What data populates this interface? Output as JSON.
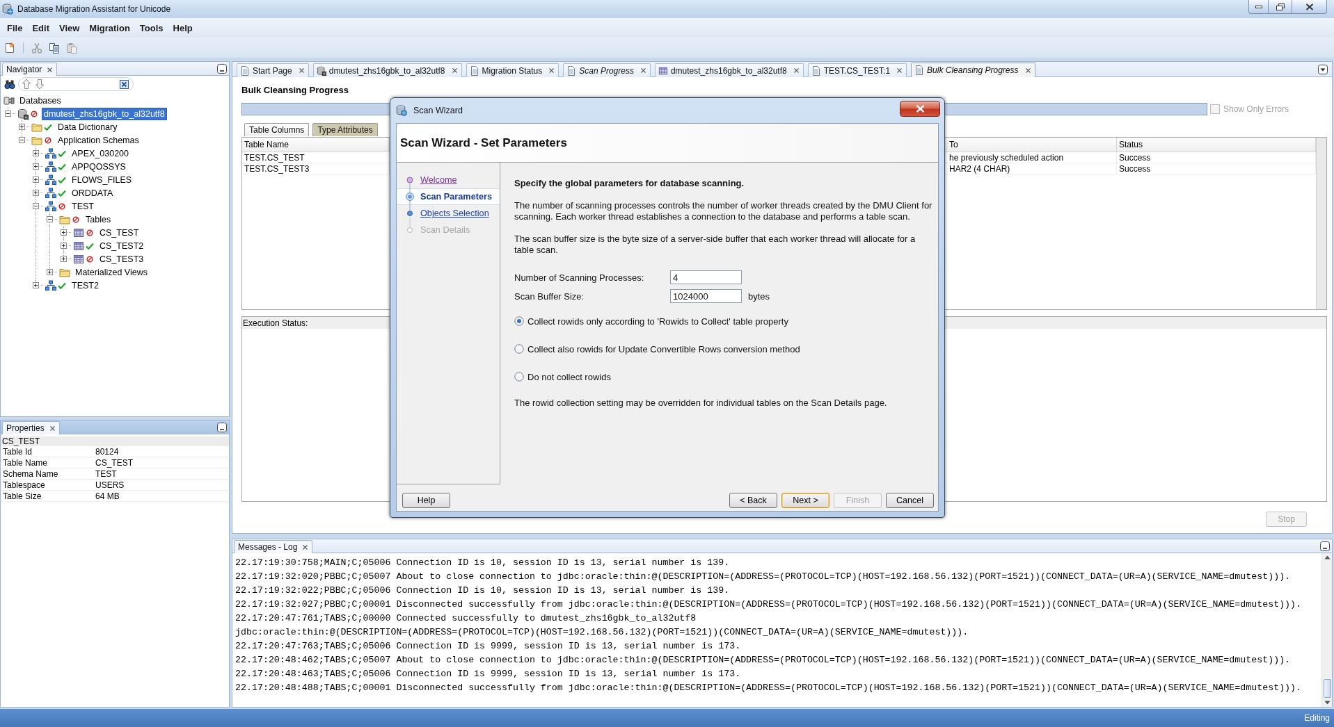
{
  "window": {
    "title": "Database Migration Assistant for Unicode"
  },
  "menu": [
    "File",
    "Edit",
    "View",
    "Migration",
    "Tools",
    "Help"
  ],
  "toolbar": [
    {
      "kind": "new",
      "disabled": false
    },
    {
      "kind": "cut",
      "disabled": true
    },
    {
      "kind": "copy",
      "disabled": false
    },
    {
      "kind": "paste",
      "disabled": true
    }
  ],
  "navigator": {
    "title": "Navigator",
    "tree": [
      {
        "label": "Databases",
        "kind": "connections",
        "selected": false,
        "children": [
          {
            "label": "dmutest_zhs16gbk_to_al32utf8",
            "kind": "database",
            "ok": false,
            "expanded": true,
            "selected": true,
            "children": [
              {
                "label": "Data Dictionary",
                "kind": "folder",
                "ok": true,
                "expanded": false,
                "selected": false
              },
              {
                "label": "Application Schemas",
                "kind": "folder",
                "ok": false,
                "expanded": true,
                "selected": false,
                "children": [
                  {
                    "label": "APEX_030200",
                    "kind": "schema",
                    "ok": true,
                    "expanded": false,
                    "selected": false
                  },
                  {
                    "label": "APPQOSSYS",
                    "kind": "schema",
                    "ok": true,
                    "expanded": false,
                    "selected": false
                  },
                  {
                    "label": "FLOWS_FILES",
                    "kind": "schema",
                    "ok": true,
                    "expanded": false,
                    "selected": false
                  },
                  {
                    "label": "ORDDATA",
                    "kind": "schema",
                    "ok": true,
                    "expanded": false,
                    "selected": false
                  },
                  {
                    "label": "TEST",
                    "kind": "schema",
                    "ok": false,
                    "expanded": true,
                    "selected": false,
                    "children": [
                      {
                        "label": "Tables",
                        "kind": "folder",
                        "ok": false,
                        "expanded": true,
                        "selected": false,
                        "children": [
                          {
                            "label": "CS_TEST",
                            "kind": "table",
                            "ok": false,
                            "expanded": false,
                            "selected": false
                          },
                          {
                            "label": "CS_TEST2",
                            "kind": "table",
                            "ok": true,
                            "expanded": false,
                            "selected": false
                          },
                          {
                            "label": "CS_TEST3",
                            "kind": "table",
                            "ok": false,
                            "expanded": false,
                            "selected": false
                          }
                        ]
                      },
                      {
                        "label": "Materialized Views",
                        "kind": "folder",
                        "expanded": false,
                        "selected": false
                      }
                    ]
                  },
                  {
                    "label": "TEST2",
                    "kind": "schema",
                    "ok": true,
                    "expanded": false,
                    "selected": false
                  }
                ]
              }
            ]
          }
        ]
      }
    ]
  },
  "properties": {
    "title": "Properties",
    "heading": "CS_TEST",
    "rows": [
      {
        "name": "Table Id",
        "value": "80124"
      },
      {
        "name": "Table Name",
        "value": "CS_TEST"
      },
      {
        "name": "Schema Name",
        "value": "TEST"
      },
      {
        "name": "Tablespace",
        "value": "USERS"
      },
      {
        "name": "Table Size",
        "value": "64 MB"
      }
    ]
  },
  "editor": {
    "tabs": [
      {
        "label": "Start Page",
        "kind": "page",
        "preview": false,
        "selected": false
      },
      {
        "label": "dmutest_zhs16gbk_to_al32utf8",
        "kind": "database",
        "preview": false,
        "selected": false
      },
      {
        "label": "Migration Status",
        "kind": "page",
        "preview": false,
        "selected": false
      },
      {
        "label": "Scan Progress",
        "kind": "page",
        "preview": true,
        "selected": false
      },
      {
        "label": "dmutest_zhs16gbk_to_al32utf8",
        "kind": "table",
        "preview": false,
        "selected": false
      },
      {
        "label": "TEST.CS_TEST:1",
        "kind": "page",
        "preview": false,
        "selected": false
      },
      {
        "label": "Bulk Cleansing Progress",
        "kind": "page",
        "preview": true,
        "selected": true
      }
    ],
    "title": "Bulk Cleansing Progress",
    "progress": {
      "level": 1
    },
    "filter": {
      "label": "Show Only Errors",
      "checked": false,
      "disabled": true
    },
    "subtabs": [
      {
        "label": "Table Columns",
        "selected": true
      },
      {
        "label": "Type Attributes",
        "selected": false
      }
    ],
    "table": {
      "columns": [
        "Table Name",
        "To",
        "Status"
      ],
      "rows": [
        [
          "TEST.CS_TEST",
          "he previously scheduled action",
          "Success"
        ],
        [
          "TEST.CS_TEST3",
          "HAR2 (4 CHAR)",
          "Success"
        ]
      ]
    },
    "execution_status": {
      "label": "Execution Status:"
    },
    "stop": {
      "label": "Stop",
      "disabled": true
    }
  },
  "messages": {
    "title": "Messages - Log",
    "lines": [
      "22.17:19:30:758;MAIN;C;05006 Connection ID is 10, session ID is 13, serial number is 139.",
      "22.17:19:32:020;PBBC;C;05007 About to close connection to jdbc:oracle:thin:@(DESCRIPTION=(ADDRESS=(PROTOCOL=TCP)(HOST=192.168.56.132)(PORT=1521))(CONNECT_DATA=(UR=A)(SERVICE_NAME=dmutest))).",
      "22.17:19:32:022;PBBC;C;05006 Connection ID is 10, session ID is 13, serial number is 139.",
      "22.17:19:32:027;PBBC;C;00001 Disconnected successfully from jdbc:oracle:thin:@(DESCRIPTION=(ADDRESS=(PROTOCOL=TCP)(HOST=192.168.56.132)(PORT=1521))(CONNECT_DATA=(UR=A)(SERVICE_NAME=dmutest))).",
      "22.17:20:47:761;TABS;C;00000 Connected successfully to dmutest_zhs16gbk_to_al32utf8",
      "jdbc:oracle:thin:@(DESCRIPTION=(ADDRESS=(PROTOCOL=TCP)(HOST=192.168.56.132)(PORT=1521))(CONNECT_DATA=(UR=A)(SERVICE_NAME=dmutest))).",
      "22.17:20:47:763;TABS;C;05006 Connection ID is 9999, session ID is 13, serial number is 173.",
      "22.17:20:48:462;TABS;C;05007 About to close connection to jdbc:oracle:thin:@(DESCRIPTION=(ADDRESS=(PROTOCOL=TCP)(HOST=192.168.56.132)(PORT=1521))(CONNECT_DATA=(UR=A)(SERVICE_NAME=dmutest))).",
      "22.17:20:48:463;TABS;C;05006 Connection ID is 9999, session ID is 13, serial number is 173.",
      "22.17:20:48:488;TABS;C;00001 Disconnected successfully from jdbc:oracle:thin:@(DESCRIPTION=(ADDRESS=(PROTOCOL=TCP)(HOST=192.168.56.132)(PORT=1521))(CONNECT_DATA=(UR=A)(SERVICE_NAME=dmutest)))."
    ]
  },
  "status_bar": {
    "text": "Editing"
  },
  "dialog": {
    "title": "Scan Wizard",
    "heading": "Scan Wizard - Set Parameters",
    "steps": [
      {
        "label": "Welcome",
        "kind": "visited",
        "selected": false
      },
      {
        "label": "Scan Parameters",
        "kind": "current",
        "selected": true
      },
      {
        "label": "Objects Selection",
        "kind": "available",
        "selected": false
      },
      {
        "label": "Scan Details",
        "kind": "unavailable",
        "selected": false
      }
    ],
    "intro": "Specify the global parameters for database scanning.",
    "paragraphs": [
      "The number of scanning processes controls the number of worker threads created by the DMU Client for scanning. Each worker thread establishes a connection to the database and performs a table scan.",
      "The scan buffer size is the byte size of a server-side buffer that each worker thread will allocate for a table scan."
    ],
    "fields": [
      {
        "label": "Number of Scanning Processes:",
        "value": "4"
      },
      {
        "label": "Scan Buffer Size:",
        "value": "1024000",
        "unit": "bytes"
      }
    ],
    "options": [
      {
        "label": "Collect rowids only according to 'Rowids to Collect' table property",
        "selected": true
      },
      {
        "label": "Collect also rowids for Update Convertible Rows conversion method",
        "selected": false
      },
      {
        "label": "Do not collect rowids",
        "selected": false
      }
    ],
    "note": "The rowid collection setting may be overridden for individual tables on the Scan Details page.",
    "buttons": [
      {
        "label": "Help",
        "kind": "help",
        "disabled": false,
        "default": false
      },
      {
        "label": "< Back",
        "kind": "navigation",
        "disabled": false,
        "default": false
      },
      {
        "label": "Next >",
        "kind": "navigation",
        "disabled": false,
        "default": true
      },
      {
        "label": "Finish",
        "kind": "navigation",
        "disabled": true,
        "default": false
      },
      {
        "label": "Cancel",
        "kind": "navigation",
        "disabled": false,
        "default": false
      }
    ]
  }
}
